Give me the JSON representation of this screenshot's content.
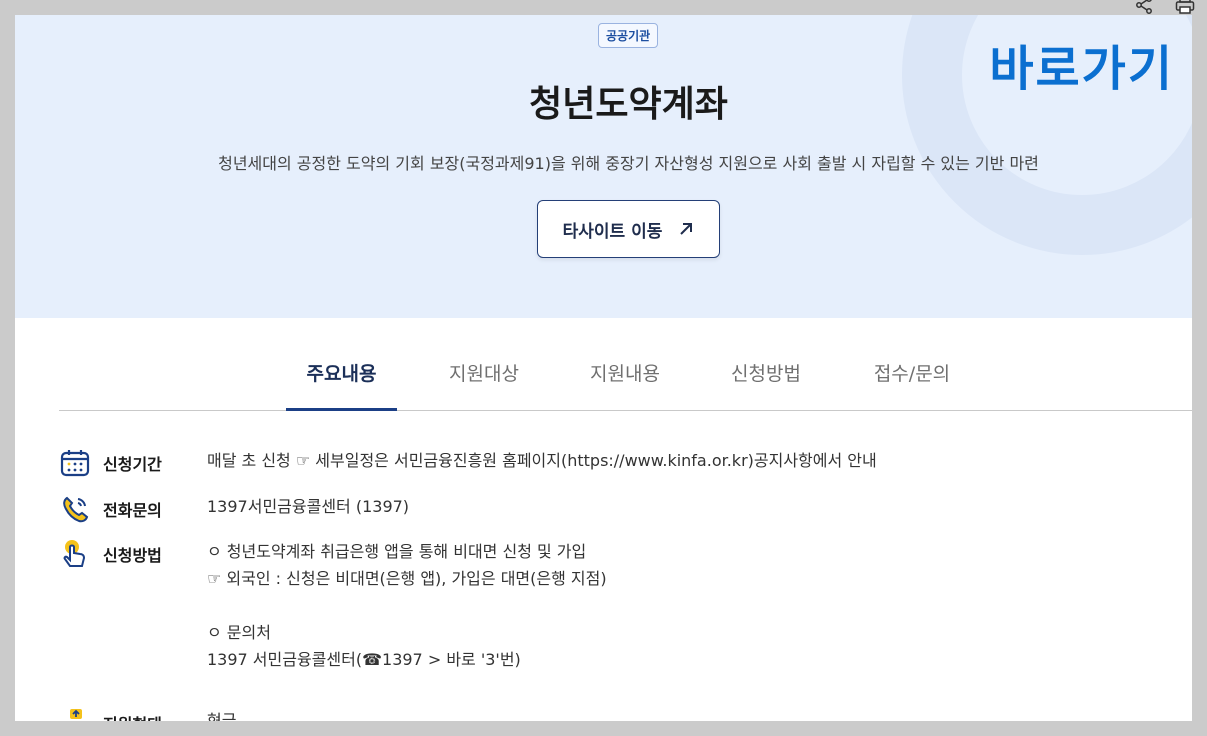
{
  "badge": "공공기관",
  "quick_link": "바로가기",
  "title": "청년도약계좌",
  "subtitle": "청년세대의 공정한 도약의 기회 보장(국정과제91)을 위해 중장기 자산형성 지원으로 사회 출발 시 자립할 수 있는 기반 마련",
  "site_button": {
    "label": "타사이트 이동",
    "icon": "arrow-up-right-icon"
  },
  "tabs": [
    {
      "label": "주요내용",
      "active": true
    },
    {
      "label": "지원대상",
      "active": false
    },
    {
      "label": "지원내용",
      "active": false
    },
    {
      "label": "신청방법",
      "active": false
    },
    {
      "label": "접수/문의",
      "active": false
    }
  ],
  "info": [
    {
      "icon": "calendar-icon",
      "label": "신청기간",
      "lines": [
        "매달 초 신청 ☞ 세부일정은 서민금융진흥원 홈페이지(https://www.kinfa.or.kr)공지사항에서 안내"
      ]
    },
    {
      "icon": "phone-icon",
      "label": "전화문의",
      "lines": [
        "1397서민금융콜센터 (1397)"
      ]
    },
    {
      "icon": "hand-tap-icon",
      "label": "신청방법",
      "lines": [
        "ㅇ 청년도약계좌 취급은행 앱을 통해 비대면 신청 및 가입",
        "☞ 외국인 : 신청은 비대면(은행 앱), 가입은 대면(은행 지점)",
        "",
        "ㅇ 문의처",
        "1397 서민금융콜센터(☎1397 > 바로 '3'번)"
      ]
    },
    {
      "icon": "support-hand-icon",
      "label": "지원형태",
      "lines": [
        "현금"
      ]
    }
  ],
  "colors": {
    "accent": "#0b6fd0",
    "navy": "#1b3f86",
    "hero_bg": "#e6effc",
    "icon_yellow": "#f4c21b"
  }
}
